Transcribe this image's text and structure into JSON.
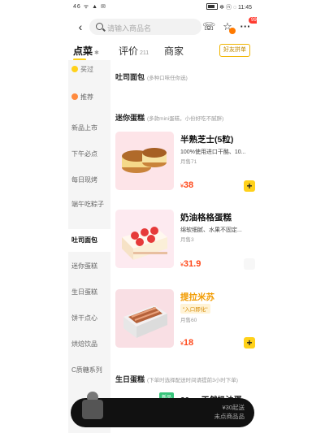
{
  "status_bar": {
    "left": "46 ᯤ ▲ ✉",
    "right": "✻ ⓝ ◌ 11:45",
    "battery": ""
  },
  "header": {
    "search_placeholder": "请输入商品名",
    "cart_badge": "99+"
  },
  "tabs": [
    {
      "label": "点菜",
      "count": ""
    },
    {
      "label": "评价",
      "count": "211"
    },
    {
      "label": "商家",
      "count": ""
    }
  ],
  "share_button": "好友拼单",
  "sidebar": {
    "categories": [
      "买过",
      "推荐",
      "新品上市",
      "下午必点",
      "每日现烤",
      "端午吃粽子",
      "吐司面包",
      "迷你蛋糕",
      "生日蛋糕",
      "饼干点心",
      "烘焙饮品",
      "C质糖系列"
    ],
    "active_index": 6
  },
  "sections": {
    "toast": {
      "title": "吐司面包",
      "subtitle": "(多种口味任你选)"
    },
    "mini_cake": {
      "title": "迷你蛋糕",
      "subtitle": "(多款mini蛋糕，小份好吃不腻胖)"
    },
    "birthday": {
      "title": "生日蛋糕",
      "subtitle": "(下单时选择配送时间请提前3小时下单)"
    }
  },
  "products": [
    {
      "name": "半熟芝士(5粒)",
      "desc": "100%使用进口干酪、10...",
      "sold": "月售71",
      "tag": "",
      "price": "38",
      "currency": "¥"
    },
    {
      "name": "奶油格格蛋糕",
      "desc": "绵软细腻、水果不固定...",
      "sold": "月售3",
      "tag": "",
      "price": "31.9",
      "currency": "¥"
    },
    {
      "name": "提拉米苏",
      "desc": "",
      "sold": "月售60",
      "tag": "\"入口即化\"",
      "price": "18",
      "currency": "¥"
    }
  ],
  "peek": {
    "badge": "新品",
    "name": "20cm天然奶油蛋"
  },
  "bottom_bar": {
    "line1": "¥30起送",
    "line2": "未点商品品"
  }
}
